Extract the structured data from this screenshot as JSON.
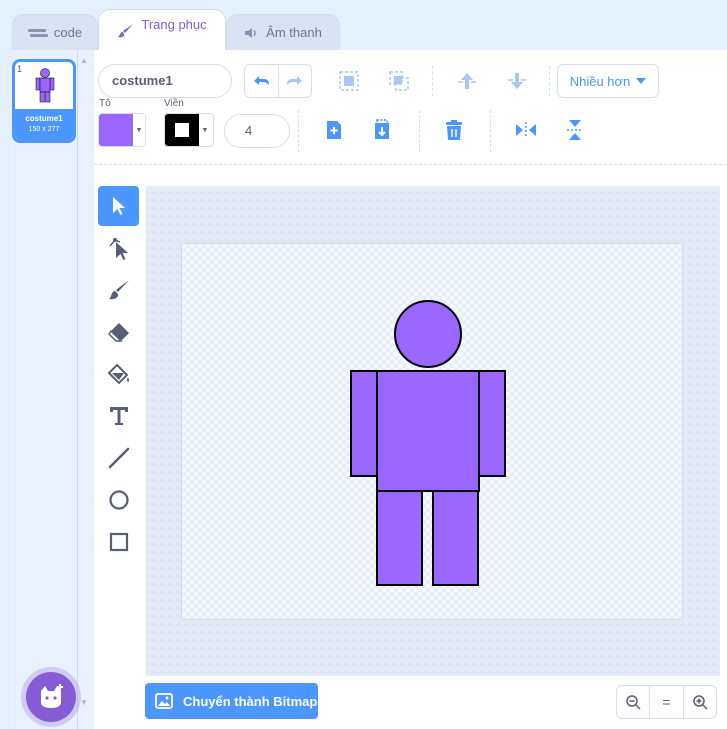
{
  "tabs": [
    {
      "label": "code",
      "icon": "code-icon"
    },
    {
      "label": "Trang phục",
      "icon": "brush-icon"
    },
    {
      "label": "Âm thanh",
      "icon": "speaker-icon"
    }
  ],
  "costume_list": {
    "items": [
      {
        "number": "1",
        "name": "costume1",
        "size": "150 x 277"
      }
    ]
  },
  "toolbar": {
    "costume_name": "costume1",
    "more_label": "Nhiều hơn",
    "fill_label": "Tô",
    "outline_label": "Viền",
    "outline_width": "4",
    "fill_color": "#9966ff",
    "outline_color": "#000000"
  },
  "tools": [
    "select-tool",
    "reshape-tool",
    "brush-tool",
    "eraser-tool",
    "fill-tool",
    "text-tool",
    "line-tool",
    "circle-tool",
    "rectangle-tool"
  ],
  "bottom": {
    "convert_label": "Chuyển thành Bitmap",
    "zoom_reset_label": "="
  },
  "colors": {
    "accent": "#4c97ff",
    "tab_active": "#855cd6",
    "sprite_fill": "#9966ff"
  }
}
